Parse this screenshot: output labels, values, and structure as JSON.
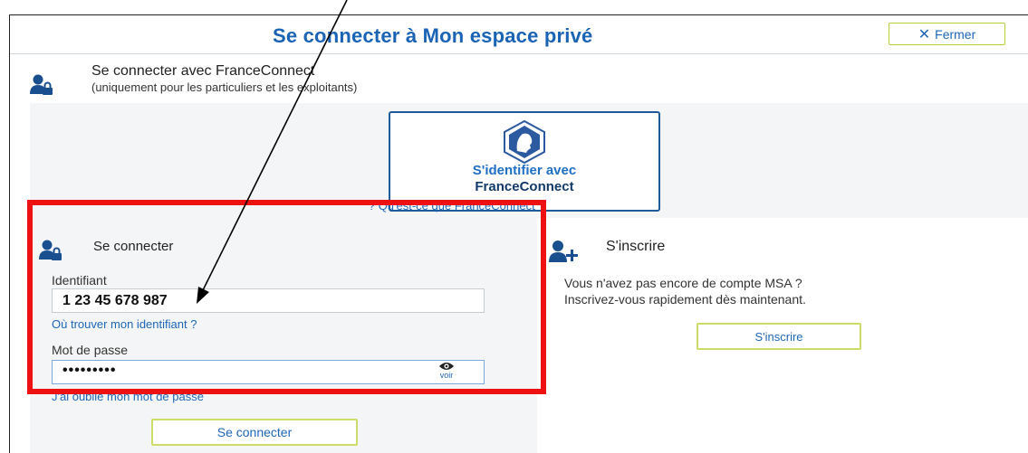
{
  "header": {
    "title": "Se connecter à Mon espace privé",
    "close_label": "Fermer"
  },
  "franceconnect": {
    "heading": "Se connecter avec FranceConnect",
    "subheading": "(uniquement pour les particuliers et les exploitants)",
    "button_line1": "S'identifier avec",
    "button_line2": "FranceConnect",
    "what_link": "Qu'est-ce que FranceConnect ?"
  },
  "login": {
    "heading": "Se connecter",
    "id_label": "Identifiant",
    "id_value": "1 23 45 678 987",
    "where_link": "Où trouver mon identifiant ?",
    "password_label": "Mot de passe",
    "password_value": "•••••••••",
    "show_label": "voir",
    "forgot_link": "J'ai oublié mon mot de passe",
    "submit_label": "Se connecter"
  },
  "signup": {
    "heading": "S'inscrire",
    "text_line1": "Vous n'avez pas encore de compte MSA ?",
    "text_line2": "Inscrivez-vous rapidement dès maintenant.",
    "button_label": "S'inscrire"
  },
  "icons": {
    "user_lock": "user-lock-icon",
    "user_add": "user-add-icon",
    "franceconnect_logo": "franceconnect-logo-icon",
    "eye": "eye-icon",
    "close": "close-icon",
    "help": "help-icon"
  },
  "colors": {
    "primary_blue": "#1a63b5",
    "accent_green": "#cddc67",
    "annotation_red": "#ee1111",
    "panel_gray": "#f4f5f6"
  }
}
